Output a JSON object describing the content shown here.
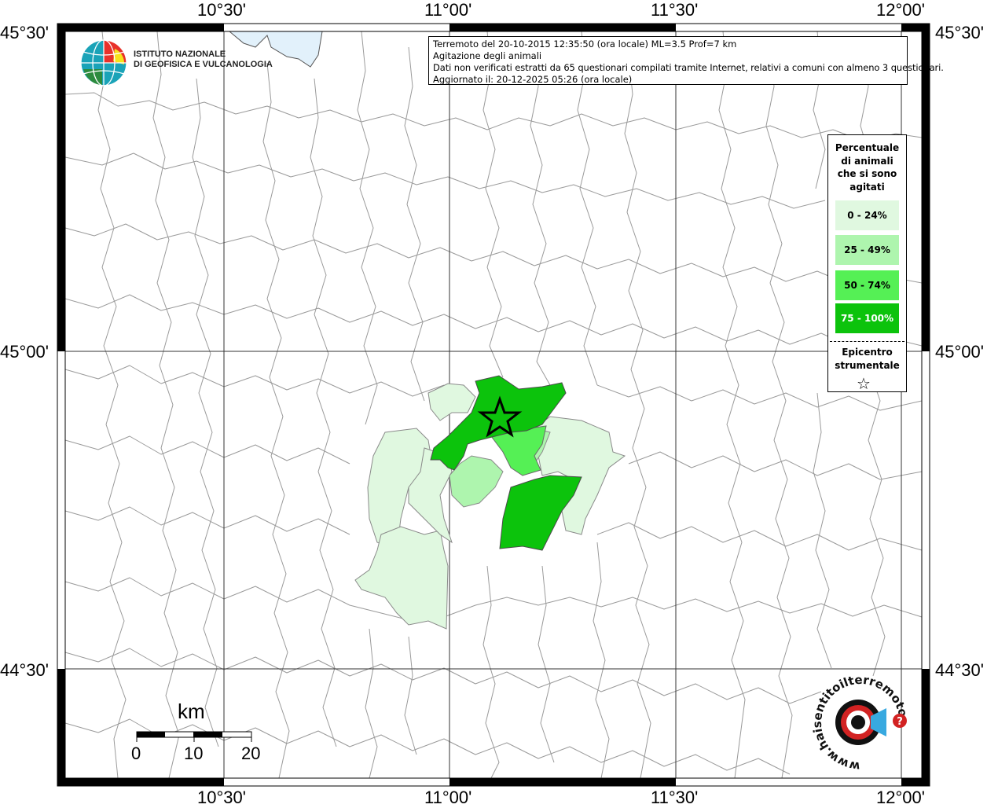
{
  "info": {
    "line1": "Terremoto del 20-10-2015 12:35:50 (ora locale) ML=3.5 Prof=7 km",
    "line2": "Agitazione degli animali",
    "line3": "Dati non verificati estratti da 65 questionari compilati tramite Internet, relativi a comuni con almeno 3 questionari.",
    "line4": "Aggiornato il: 20-12-2025 05:26 (ora locale)"
  },
  "ticks": {
    "top": [
      "10°30'",
      "11°00'",
      "11°30'",
      "12°00'"
    ],
    "bottom": [
      "10°30'",
      "11°00'",
      "11°30'",
      "12°00'"
    ],
    "left": [
      "45°30'",
      "45°00'",
      "44°30'"
    ],
    "right": [
      "45°30'",
      "45°00'",
      "44°30'"
    ]
  },
  "logo": {
    "line1": "ISTITUTO NAZIONALE",
    "line2": "DI GEOFISICA E VULCANOLOGIA",
    "hst_text": "www.haisentitoilterremoto.it"
  },
  "legend": {
    "title": [
      "Percentuale",
      "di animali",
      "che si sono",
      "agitati"
    ],
    "classes": [
      {
        "label": "0 - 24%",
        "color": "#e0f8e0",
        "text_color": "#000000"
      },
      {
        "label": "25 - 49%",
        "color": "#aef5ae",
        "text_color": "#000000"
      },
      {
        "label": "50 - 74%",
        "color": "#55f055",
        "text_color": "#000000"
      },
      {
        "label": "75 - 100%",
        "color": "#0cc30c",
        "text_color": "#ffffff"
      }
    ],
    "epicenter_title": [
      "Epicentro",
      "strumentale"
    ],
    "epicenter_symbol": "☆"
  },
  "scale": {
    "unit": "km",
    "labels": [
      "0",
      "10",
      "20"
    ]
  },
  "colors": {
    "boundary": "#9a9a9a",
    "grid": "#333333",
    "water": "#e2f1fb",
    "frame": "#000000"
  }
}
